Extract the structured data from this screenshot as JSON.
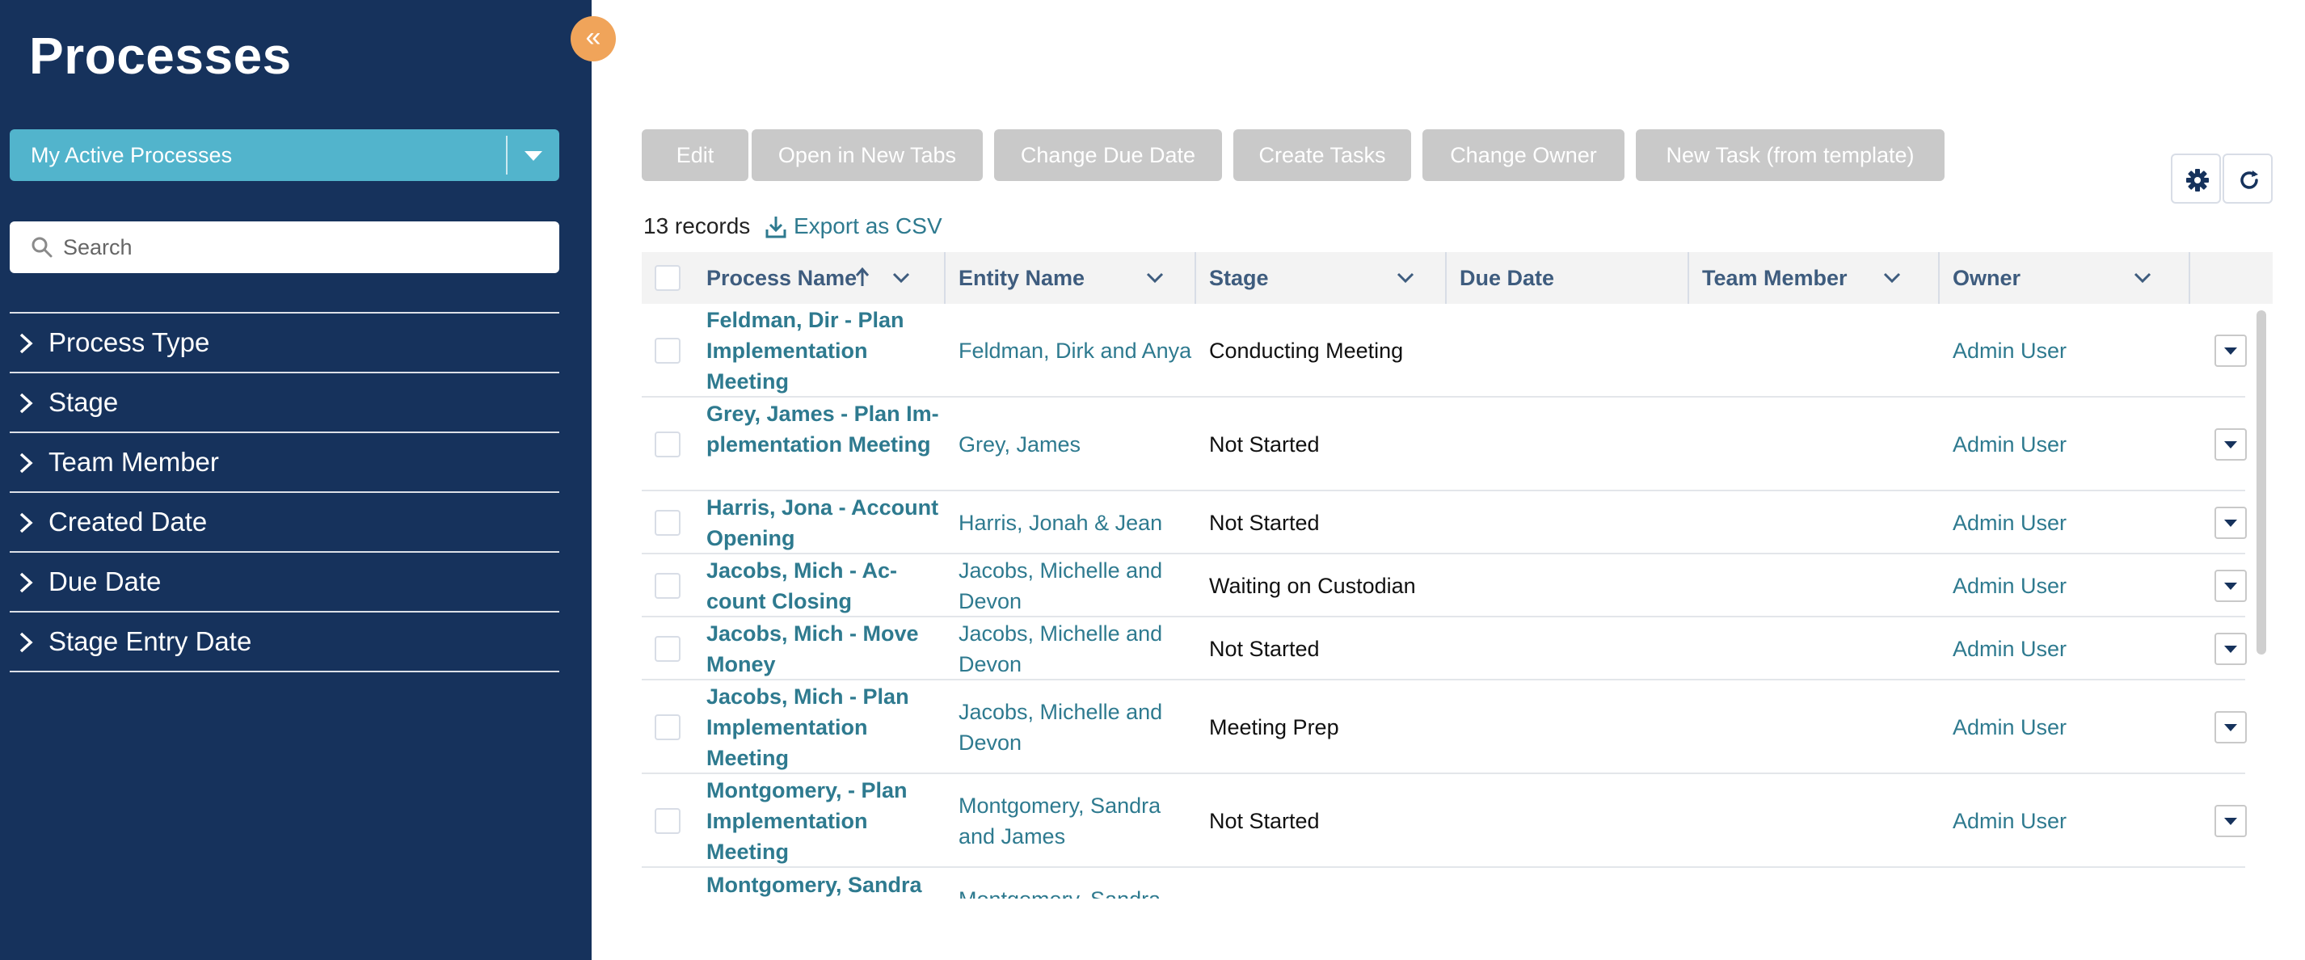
{
  "sidebar": {
    "title": "Processes",
    "view_select": "My Active Processes",
    "search_placeholder": "Search",
    "filters": [
      "Process Type",
      "Stage",
      "Team Member",
      "Created Date",
      "Due Date",
      "Stage Entry Date"
    ]
  },
  "toolbar": {
    "buttons": [
      "Edit",
      "Open in New Tabs",
      "Change Due Date",
      "Create Tasks",
      "Change Owner",
      "New Task (from template)"
    ],
    "settings_icon": "gear-icon",
    "refresh_icon": "refresh-icon"
  },
  "list": {
    "record_count": "13 records",
    "export_label": "Export as CSV"
  },
  "table": {
    "columns": [
      "Process Name",
      "Entity Name",
      "Stage",
      "Due Date",
      "Team Member",
      "Owner"
    ],
    "sorted_column": "Process Name",
    "sort_direction": "ascending",
    "rows": [
      {
        "name": "Feldman, Dir - Plan Implementation Meeting",
        "entity": "Feldman, Dirk and Anya",
        "stage": "Conducting Meeting",
        "due_date": "",
        "team_member": "",
        "owner": "Admin User"
      },
      {
        "name": "Grey, James - Plan Im-plementation Meeting",
        "entity": "Grey, James",
        "stage": "Not Started",
        "due_date": "",
        "team_member": "",
        "owner": "Admin User"
      },
      {
        "name": "Harris, Jona - Account Opening",
        "entity": "Harris, Jonah & Jean",
        "stage": "Not Started",
        "due_date": "",
        "team_member": "",
        "owner": "Admin User"
      },
      {
        "name": "Jacobs, Mich - Ac-count Closing",
        "entity": "Jacobs, Michelle and Devon",
        "stage": "Waiting on Custodian",
        "due_date": "",
        "team_member": "",
        "owner": "Admin User"
      },
      {
        "name": "Jacobs, Mich - Move Money",
        "entity": "Jacobs, Michelle and Devon",
        "stage": "Not Started",
        "due_date": "",
        "team_member": "",
        "owner": "Admin User"
      },
      {
        "name": "Jacobs, Mich - Plan Implementation Meeting",
        "entity": "Jacobs, Michelle and Devon",
        "stage": "Meeting Prep",
        "due_date": "",
        "team_member": "",
        "owner": "Admin User"
      },
      {
        "name": "Montgomery, - Plan Implementation Meeting",
        "entity": "Montgomery, Sandra and James",
        "stage": "Not Started",
        "due_date": "",
        "team_member": "",
        "owner": "Admin User"
      },
      {
        "name": "Montgomery, Sandra",
        "entity": "Montgomery, Sandra",
        "stage": "",
        "due_date": "",
        "team_member": "",
        "owner": ""
      }
    ]
  },
  "colors": {
    "sidebar_bg": "#16325c",
    "view_select_bg": "#52b4cc",
    "collapse_button_bg": "#f0a45a",
    "link_text": "#2e7a8f",
    "disabled_button_bg": "#c9c9c9"
  }
}
